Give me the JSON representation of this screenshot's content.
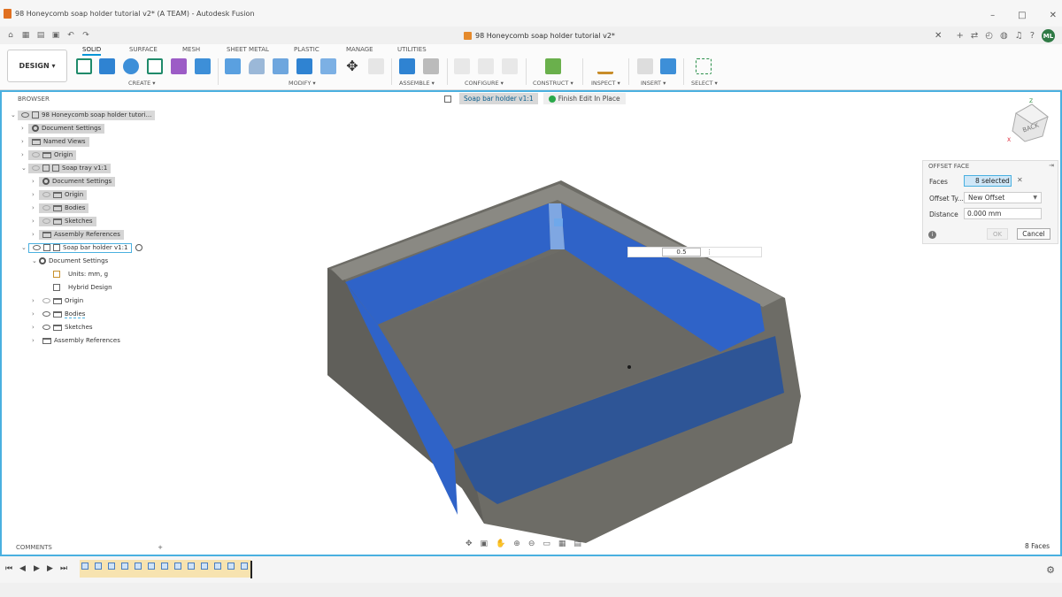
{
  "window": {
    "title": "98 Honeycomb soap holder tutorial v2* (A TEAM) - Autodesk Fusion",
    "controls": [
      "–",
      "□",
      "✕"
    ]
  },
  "document_tab": {
    "label": "98 Honeycomb soap holder tutorial v2*"
  },
  "user": {
    "initials": "ML"
  },
  "ribbon": {
    "workspace": "DESIGN ▾",
    "tabs": [
      "SOLID",
      "SURFACE",
      "MESH",
      "SHEET METAL",
      "PLASTIC",
      "MANAGE",
      "UTILITIES"
    ],
    "active_tab": "SOLID",
    "groups": [
      "CREATE ▾",
      "MODIFY ▾",
      "ASSEMBLE ▾",
      "CONFIGURE ▾",
      "CONSTRUCT ▾",
      "INSPECT ▾",
      "INSERT ▾",
      "SELECT ▾"
    ]
  },
  "browser": {
    "title": "BROWSER",
    "items": [
      {
        "label": "98 Honeycomb soap holder tutori...",
        "depth": 0,
        "icon": "component-icon",
        "expanded": true
      },
      {
        "label": "Document Settings",
        "depth": 1,
        "icon": "gear-icon"
      },
      {
        "label": "Named Views",
        "depth": 1,
        "icon": "folder-icon"
      },
      {
        "label": "Origin",
        "depth": 1,
        "icon": "folder-icon"
      },
      {
        "label": "Soap tray v1:1",
        "depth": 1,
        "icon": "component-icon",
        "expanded": true
      },
      {
        "label": "Document Settings",
        "depth": 2,
        "icon": "gear-icon"
      },
      {
        "label": "Origin",
        "depth": 2,
        "icon": "folder-icon"
      },
      {
        "label": "Bodies",
        "depth": 2,
        "icon": "folder-icon"
      },
      {
        "label": "Sketches",
        "depth": 2,
        "icon": "folder-icon"
      },
      {
        "label": "Assembly References",
        "depth": 2,
        "icon": "folder-icon"
      },
      {
        "label": "Soap bar holder v1:1",
        "depth": 1,
        "icon": "component-icon",
        "expanded": true,
        "active": true
      },
      {
        "label": "Document Settings",
        "depth": 2,
        "icon": "gear-icon"
      },
      {
        "label": "Units: mm, g",
        "depth": 3,
        "icon": "units-icon"
      },
      {
        "label": "Hybrid Design",
        "depth": 3,
        "icon": "design-icon"
      },
      {
        "label": "Origin",
        "depth": 2,
        "icon": "folder-icon"
      },
      {
        "label": "Bodies",
        "depth": 2,
        "icon": "folder-icon"
      },
      {
        "label": "Sketches",
        "depth": 2,
        "icon": "folder-icon"
      },
      {
        "label": "Assembly References",
        "depth": 2,
        "icon": "folder-icon"
      }
    ]
  },
  "edit_in_place": {
    "component": "Soap bar holder v1:1",
    "finish_label": "Finish Edit In Place"
  },
  "offset_face": {
    "title": "OFFSET FACE",
    "faces_label": "Faces",
    "faces_value": "8 selected",
    "offset_type_label": "Offset Ty...",
    "offset_type_value": "New Offset",
    "distance_label": "Distance",
    "distance_value": "0.000 mm",
    "ok_label": "OK",
    "cancel_label": "Cancel"
  },
  "canvas_input": {
    "value": "0.5"
  },
  "viewcube": {
    "face": "BACK",
    "axis_z": "Z",
    "axis_x": "X"
  },
  "comments": {
    "title": "COMMENTS"
  },
  "status": {
    "face_count": "8 Faces"
  },
  "colors": {
    "accent": "#0696d7",
    "selected_face": "#2f63c8",
    "body": "#6d6c66"
  }
}
